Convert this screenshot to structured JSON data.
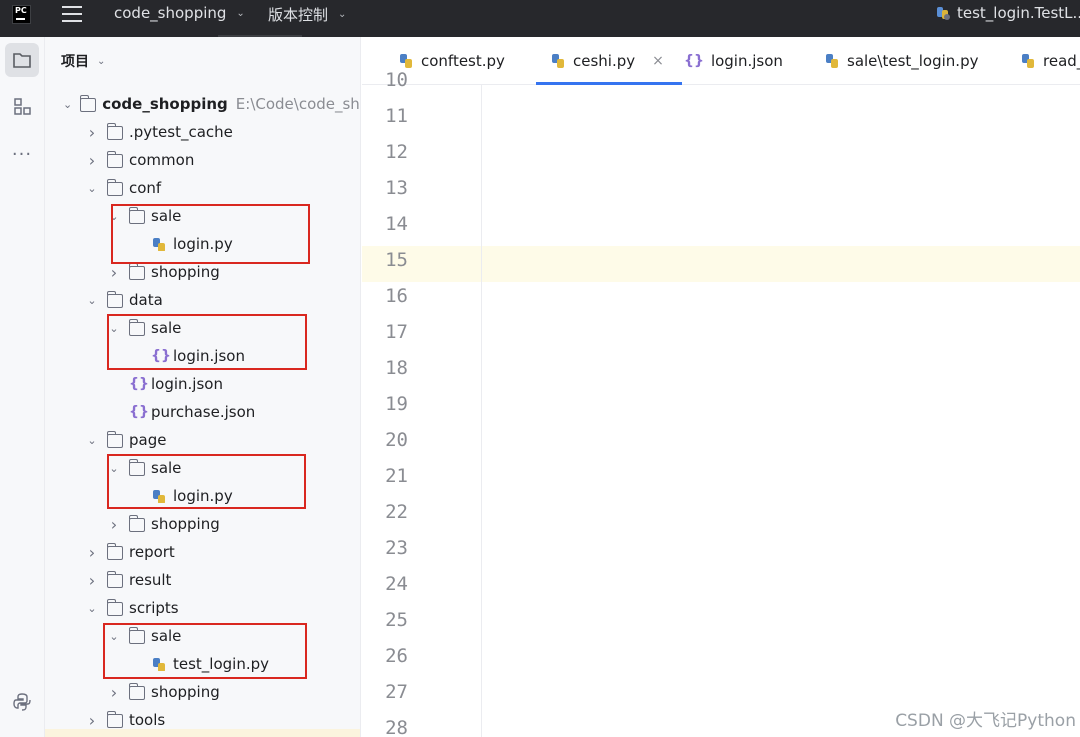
{
  "titlebar": {
    "project_name": "code_shopping",
    "vcs_label": "版本控制",
    "run_config": "test_login.TestL..."
  },
  "toolstrip": {
    "items": [
      "project",
      "structure",
      "more"
    ]
  },
  "project_panel": {
    "header": "项目",
    "root": {
      "name": "code_shopping",
      "path": "E:\\Code\\code_sho"
    },
    "rows": [
      {
        "label": ".pytest_cache",
        "type": "folder",
        "expanded": false
      },
      {
        "label": "common",
        "type": "folder",
        "expanded": false
      },
      {
        "label": "conf",
        "type": "folder",
        "expanded": true
      },
      {
        "label": "sale",
        "type": "folder",
        "expanded": true
      },
      {
        "label": "login.py",
        "type": "python"
      },
      {
        "label": "shopping",
        "type": "folder",
        "expanded": false
      },
      {
        "label": "data",
        "type": "folder",
        "expanded": true
      },
      {
        "label": "sale",
        "type": "folder",
        "expanded": true
      },
      {
        "label": "login.json",
        "type": "json"
      },
      {
        "label": "login.json",
        "type": "json"
      },
      {
        "label": "purchase.json",
        "type": "json"
      },
      {
        "label": "page",
        "type": "folder",
        "expanded": true
      },
      {
        "label": "sale",
        "type": "folder",
        "expanded": true
      },
      {
        "label": "login.py",
        "type": "python"
      },
      {
        "label": "shopping",
        "type": "folder",
        "expanded": false
      },
      {
        "label": "report",
        "type": "folder",
        "expanded": false
      },
      {
        "label": "result",
        "type": "folder",
        "expanded": false
      },
      {
        "label": "scripts",
        "type": "folder",
        "expanded": true
      },
      {
        "label": "sale",
        "type": "folder",
        "expanded": true
      },
      {
        "label": "test_login.py",
        "type": "python"
      },
      {
        "label": "shopping",
        "type": "folder",
        "expanded": false
      },
      {
        "label": "tools",
        "type": "folder",
        "expanded": false
      }
    ]
  },
  "editor": {
    "tabs": [
      {
        "label": "conftest.py",
        "type": "python"
      },
      {
        "label": "ceshi.py",
        "type": "python",
        "active": true,
        "close": "×"
      },
      {
        "label": "login.json",
        "type": "json"
      },
      {
        "label": "sale\\test_login.py",
        "type": "python"
      },
      {
        "label": "read_",
        "type": "python"
      }
    ],
    "line_numbers": [
      "10",
      "11",
      "12",
      "13",
      "14",
      "15",
      "16",
      "17",
      "18",
      "19",
      "20",
      "21",
      "22",
      "23",
      "24",
      "25",
      "26",
      "27",
      "28"
    ],
    "current_line": "15"
  },
  "watermark": "CSDN @大飞记Python",
  "colors": {
    "titlebar_bg": "#27282c",
    "panel_bg": "#f7f8fa",
    "highlight_box": "#d9271f",
    "tab_active_underline": "#3574f0",
    "current_line_bg": "#fefbe8",
    "json_icon": "#8a6fd1"
  }
}
